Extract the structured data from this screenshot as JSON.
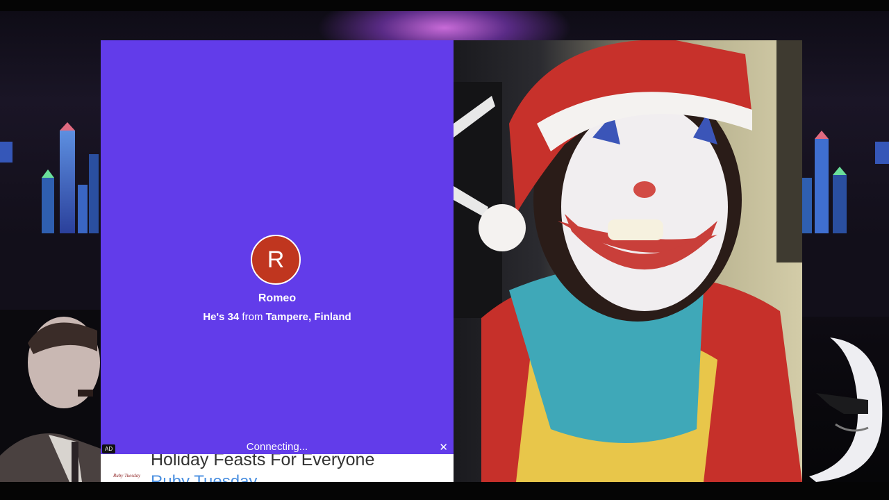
{
  "chat": {
    "avatar_initial": "R",
    "username": "Romeo",
    "info": {
      "prefix": "He's ",
      "age": "34",
      "mid": " from ",
      "location": "Tampere, Finland"
    },
    "status": "Connecting..."
  },
  "ad": {
    "badge": "AD",
    "close_glyph": "✕",
    "logo": "Ruby Tuesday",
    "headline": "Holiday Feasts For Everyone",
    "brand": "Ruby Tuesday"
  },
  "colors": {
    "panel_bg": "#623cea",
    "avatar_bg": "#c0361f"
  }
}
